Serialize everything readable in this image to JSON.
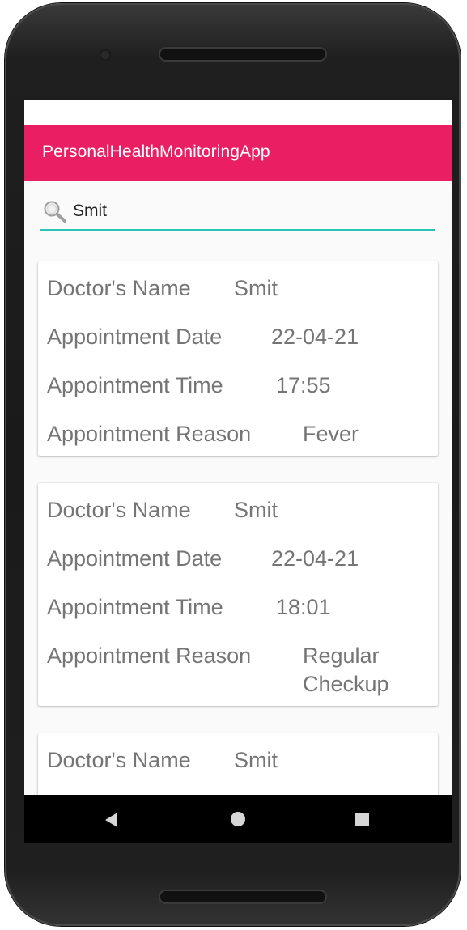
{
  "app": {
    "title": "PersonalHealthMonitoringApp"
  },
  "colors": {
    "appbar": "#e91e63",
    "search_underline": "#26c6b5",
    "text_secondary": "#757575"
  },
  "search": {
    "value": "Smit",
    "icon": "search-icon"
  },
  "labels": {
    "doctor_name": "Doctor's Name",
    "appointment_date": "Appointment Date",
    "appointment_time": "Appointment Time",
    "appointment_reason": "Appointment Reason"
  },
  "appointments": [
    {
      "doctor": "Smit",
      "date": "22-04-21",
      "time": "17:55",
      "reason": "Fever"
    },
    {
      "doctor": "Smit",
      "date": "22-04-21",
      "time": "18:01",
      "reason": "Regular Checkup"
    },
    {
      "doctor": "Smit"
    }
  ],
  "navbar": {
    "back": "back-icon",
    "home": "home-icon",
    "recents": "recents-icon"
  }
}
